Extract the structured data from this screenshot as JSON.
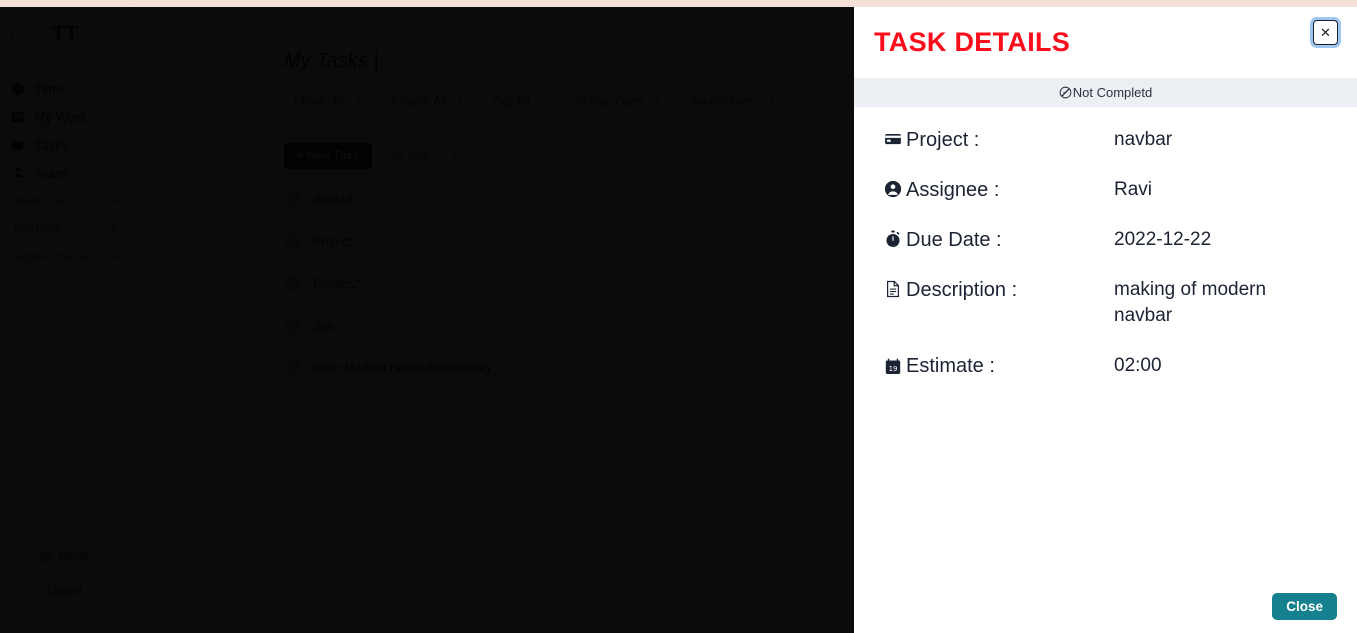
{
  "theme": {
    "top_strip_color": "#f5e0d7",
    "title_color": "#fc0d1b",
    "status_bar_color": "#eceff3",
    "close_button_color": "#15808e",
    "new_task_button_color": "#0d2b5c"
  },
  "sidebar": {
    "logo_mark": "TT",
    "logo_sub": "TIME TRACKER",
    "collapse_icon": "chevron-left-icon",
    "items": [
      {
        "label": "Time",
        "icon": "clock-icon"
      },
      {
        "label": "My Work",
        "icon": "list-icon"
      },
      {
        "label": "Tasks",
        "icon": "folder-icon"
      },
      {
        "label": "Team",
        "icon": "team-icon"
      }
    ],
    "sections": [
      {
        "label": "ANALYZE",
        "chevron": "chevron-down-icon"
      },
      {
        "label": "MANAGE",
        "chevron": "chevron-down-icon"
      },
      {
        "label": "WORKSPACE",
        "chevron": "chevron-down-icon"
      }
    ],
    "account_label": "admin",
    "logout_label": "Logout"
  },
  "main": {
    "page_title": "My Tasks",
    "title_caret": "|",
    "filters": [
      {
        "label": "Client : All"
      },
      {
        "label": "Project: All"
      },
      {
        "label": "Tag: All"
      },
      {
        "label": "Status: Open"
      },
      {
        "label": "Source:Inter.."
      }
    ],
    "new_task_label": "+ New Task",
    "all_task_label": "All Task",
    "tasks": [
      {
        "name": "Anshul"
      },
      {
        "name": "Project"
      },
      {
        "name": "Project2"
      },
      {
        "name": "dsa"
      },
      {
        "name": "code Modern Hover functionality"
      }
    ]
  },
  "modal": {
    "title": "TASK DETAILS",
    "close_icon": "close-icon",
    "status_text": "Not Completd",
    "status_icon": "not-completed-icon",
    "rows": [
      {
        "icon": "credit-card-icon",
        "label": "Project :",
        "value": "navbar"
      },
      {
        "icon": "person-icon",
        "label": "Assignee :",
        "value": "Ravi"
      },
      {
        "icon": "stopwatch-icon",
        "label": "Due Date :",
        "value": "2022-12-22"
      },
      {
        "icon": "document-icon",
        "label": "Description :",
        "value": "making of modern navbar"
      },
      {
        "icon": "calendar-icon",
        "label": "Estimate :",
        "value": "02:00"
      }
    ],
    "footer_close_label": "Close"
  }
}
